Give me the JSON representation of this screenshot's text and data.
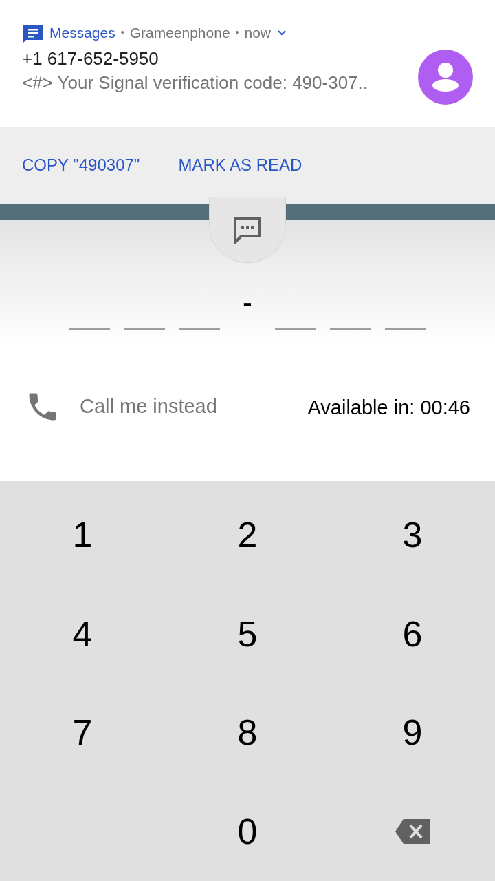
{
  "notification": {
    "app": "Messages",
    "separator_1": "•",
    "carrier": "Grameenphone",
    "separator_2": "•",
    "time": "now",
    "expanded": false,
    "sender": "+1 617-652-5950",
    "preview": "<#> Your Signal verification code: 490-307..",
    "actions": [
      "COPY \"490307\"",
      "MARK AS READ"
    ]
  },
  "code_entry": {
    "separator": "-"
  },
  "call": {
    "label": "Call me instead",
    "disabled": true,
    "countdown": "Available in: 00:46"
  },
  "keypad": [
    {
      "kind": "digit",
      "label": "1"
    },
    {
      "kind": "digit",
      "label": "2"
    },
    {
      "kind": "digit",
      "label": "3"
    },
    {
      "kind": "digit",
      "label": "4"
    },
    {
      "kind": "digit",
      "label": "5"
    },
    {
      "kind": "digit",
      "label": "6"
    },
    {
      "kind": "digit",
      "label": "7"
    },
    {
      "kind": "digit",
      "label": "8"
    },
    {
      "kind": "digit",
      "label": "9"
    },
    {
      "kind": "blank"
    },
    {
      "kind": "digit",
      "label": "0"
    },
    {
      "kind": "backspace"
    }
  ]
}
